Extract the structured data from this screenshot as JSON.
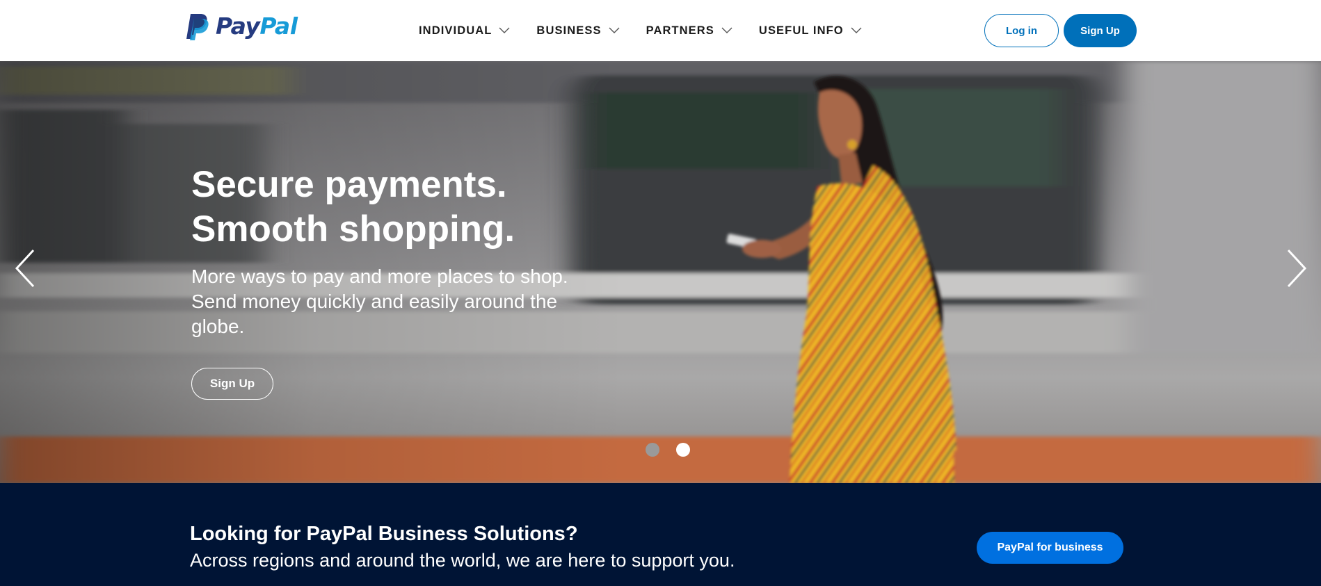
{
  "header": {
    "logo": {
      "text_pay": "Pay",
      "text_pal": "Pal",
      "icon": "paypal-monogram-icon"
    },
    "nav": [
      {
        "label": "INDIVIDUAL",
        "icon": "chevron-down-icon"
      },
      {
        "label": "BUSINESS",
        "icon": "chevron-down-icon"
      },
      {
        "label": "PARTNERS",
        "icon": "chevron-down-icon"
      },
      {
        "label": "USEFUL INFO",
        "icon": "chevron-down-icon"
      }
    ],
    "login_label": "Log in",
    "signup_label": "Sign Up"
  },
  "hero": {
    "title_line1": "Secure payments.",
    "title_line2": "Smooth shopping.",
    "subtitle": "More ways to pay and more places to shop. Send money quickly and easily around the globe.",
    "cta_label": "Sign Up",
    "prev_icon": "chevron-left-icon",
    "next_icon": "chevron-right-icon",
    "carousel": {
      "slides": 2,
      "active_index": 1
    }
  },
  "business_banner": {
    "title": "Looking for PayPal Business Solutions?",
    "subtitle": "Across regions and around the world, we are here to support you.",
    "button_label": "PayPal for business"
  },
  "colors": {
    "brand_dark_blue": "#253b80",
    "brand_light_blue": "#179bd7",
    "primary_button": "#0070ba",
    "business_button": "#0070e0",
    "banner_background": "#001435"
  }
}
